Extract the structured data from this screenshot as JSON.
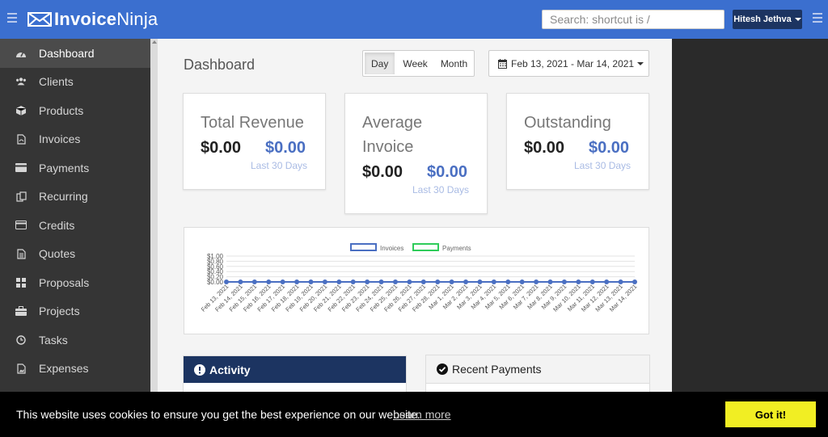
{
  "app": {
    "name_bold": "Invoice",
    "name_light": "Ninja"
  },
  "header": {
    "search_placeholder": "Search: shortcut is /",
    "user_name": "Hitesh Jethva"
  },
  "sidebar": {
    "items": [
      {
        "label": "Dashboard",
        "icon": "dashboard-icon",
        "active": true
      },
      {
        "label": "Clients",
        "icon": "users-icon"
      },
      {
        "label": "Products",
        "icon": "cube-icon"
      },
      {
        "label": "Invoices",
        "icon": "file-pdf-icon"
      },
      {
        "label": "Payments",
        "icon": "credit-card-icon"
      },
      {
        "label": "Recurring",
        "icon": "files-icon"
      },
      {
        "label": "Credits",
        "icon": "credit-card-icon"
      },
      {
        "label": "Quotes",
        "icon": "file-text-icon"
      },
      {
        "label": "Proposals",
        "icon": "th-large-icon"
      },
      {
        "label": "Projects",
        "icon": "briefcase-icon"
      },
      {
        "label": "Tasks",
        "icon": "clock-icon"
      },
      {
        "label": "Expenses",
        "icon": "file-image-icon"
      }
    ]
  },
  "main": {
    "title": "Dashboard",
    "period_tabs": [
      "Day",
      "Week",
      "Month"
    ],
    "active_period": "Day",
    "date_range": "Feb 13, 2021 - Mar 14, 2021"
  },
  "cards": [
    {
      "title": "Total Revenue",
      "value": "$0.00",
      "value_alt": "$0.00",
      "sub": "Last 30 Days"
    },
    {
      "title_line1": "Average",
      "title_line2": "Invoice",
      "value": "$0.00",
      "value_alt": "$0.00",
      "sub": "Last 30 Days"
    },
    {
      "title": "Outstanding",
      "value": "$0.00",
      "value_alt": "$0.00",
      "sub": "Last 30 Days"
    }
  ],
  "chart_data": {
    "type": "line",
    "x": [
      "Feb 13, 2021",
      "Feb 14, 2021",
      "Feb 15, 2021",
      "Feb 16, 2021",
      "Feb 17, 2021",
      "Feb 18, 2021",
      "Feb 19, 2021",
      "Feb 20, 2021",
      "Feb 21, 2021",
      "Feb 22, 2021",
      "Feb 23, 2021",
      "Feb 24, 2021",
      "Feb 25, 2021",
      "Feb 26, 2021",
      "Feb 27, 2021",
      "Feb 28, 2021",
      "Mar 1, 2021",
      "Mar 2, 2021",
      "Mar 3, 2021",
      "Mar 4, 2021",
      "Mar 5, 2021",
      "Mar 6, 2021",
      "Mar 7, 2021",
      "Mar 8, 2021",
      "Mar 9, 2021",
      "Mar 10, 2021",
      "Mar 11, 2021",
      "Mar 12, 2021",
      "Mar 13, 2021",
      "Mar 14, 2021"
    ],
    "series": [
      {
        "name": "Invoices",
        "color": "#4a6fc2",
        "values": [
          0,
          0,
          0,
          0,
          0,
          0,
          0,
          0,
          0,
          0,
          0,
          0,
          0,
          0,
          0,
          0,
          0,
          0,
          0,
          0,
          0,
          0,
          0,
          0,
          0,
          0,
          0,
          0,
          0,
          0
        ]
      },
      {
        "name": "Payments",
        "color": "#2ecc5a",
        "values": [
          0,
          0,
          0,
          0,
          0,
          0,
          0,
          0,
          0,
          0,
          0,
          0,
          0,
          0,
          0,
          0,
          0,
          0,
          0,
          0,
          0,
          0,
          0,
          0,
          0,
          0,
          0,
          0,
          0,
          0
        ]
      }
    ],
    "yticks": [
      "$1.00",
      "$0.80",
      "$0.60",
      "$0.40",
      "$0.20",
      "$0.00"
    ],
    "ylim": [
      0,
      1
    ],
    "grid": true,
    "legend": "top"
  },
  "panels": {
    "activity_title": "Activity",
    "payments_title": "Recent Payments"
  },
  "cookie": {
    "message": "This website uses cookies to ensure you get the best experience on our website.",
    "learn_more": "Learn more",
    "button": "Got it!"
  }
}
